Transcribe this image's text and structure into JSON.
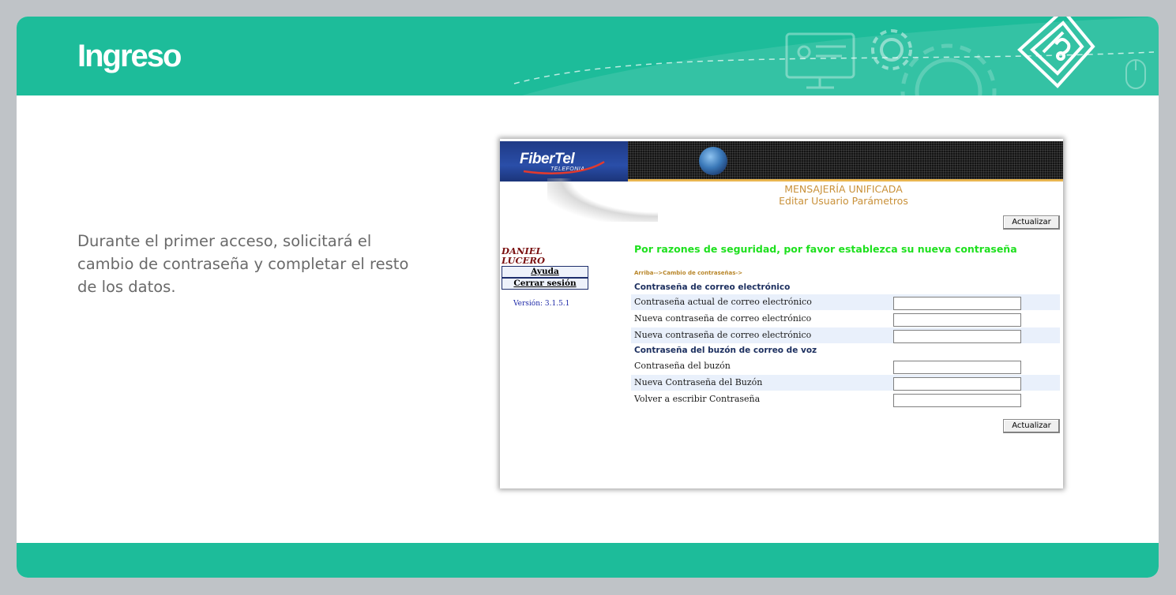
{
  "slide": {
    "title": "Ingreso",
    "description": "Durante el primer acceso, solicitará el cambio de contraseña y completar el resto de los datos.",
    "colors": {
      "accent": "#1dbc9a",
      "background": "#ffffff",
      "frame": "#bfc3c7"
    }
  },
  "app": {
    "logo": "FiberTel",
    "logo_sub": "TELEFONIA",
    "title_line1": "MENSAJERÍA UNIFICADA",
    "title_line2": "Editar Usuario Parámetros",
    "update_button": "Actualizar",
    "user_line1": "DANIEL",
    "user_line2": "LUCERO",
    "help_button": "Ayuda",
    "logout_button": "Cerrar sesión",
    "version": "Versión: 3.1.5.1",
    "security_message": "Por razones de seguridad, por favor establezca su nueva contraseña",
    "breadcrumb": "Arriba-->Cambio de contraseñas->",
    "email_section": {
      "heading": "Contraseña de correo electrónico",
      "fields": [
        {
          "label": "Contraseña actual de correo electrónico",
          "value": ""
        },
        {
          "label": "Nueva contraseña de correo electrónico",
          "value": ""
        },
        {
          "label": "Nueva contraseña de correo electrónico",
          "value": ""
        }
      ]
    },
    "voicemail_section": {
      "heading": "Contraseña del buzón de correo de voz",
      "fields": [
        {
          "label": "Contraseña del buzón",
          "value": ""
        },
        {
          "label": "Nueva Contraseña del Buzón",
          "value": ""
        },
        {
          "label": "Volver a escribir Contraseña",
          "value": ""
        }
      ]
    }
  }
}
